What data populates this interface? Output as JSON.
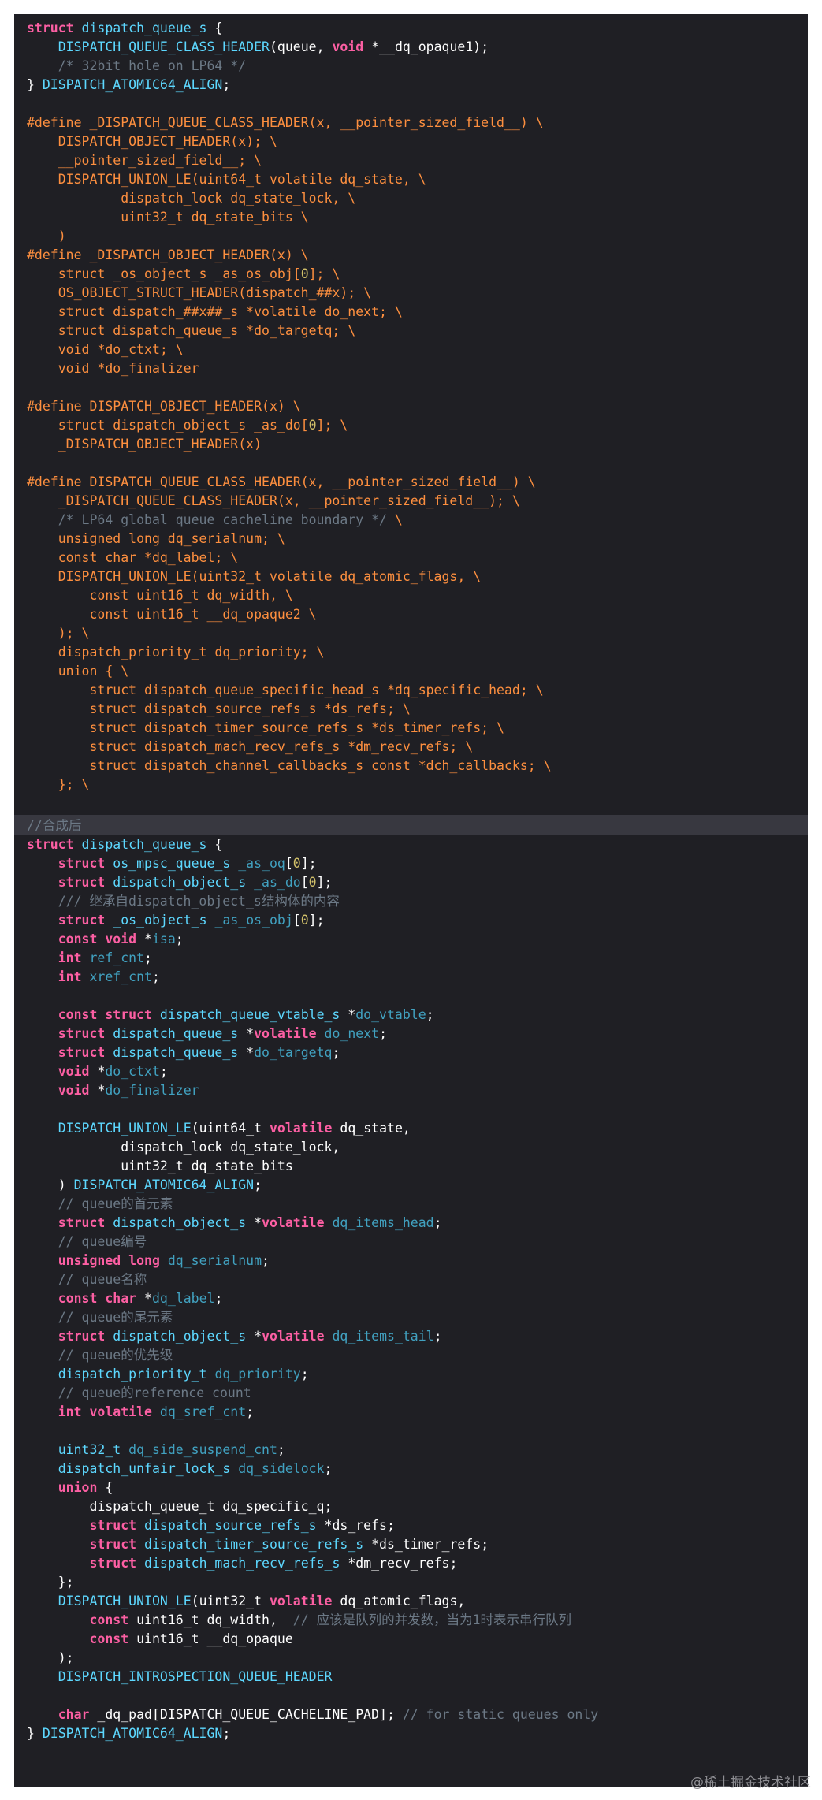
{
  "colors": {
    "background": "#1f1f24",
    "keyword": "#fc5fa3",
    "type": "#5dd8ff",
    "macro": "#fd8f3f",
    "comment": "#6c7986",
    "number": "#d0bf69",
    "plain": "#ffffff",
    "identifier": "#41a1c0"
  },
  "code_top": [
    [
      [
        "kw",
        "struct "
      ],
      [
        "type",
        "dispatch_queue_s"
      ],
      [
        "txt",
        " {"
      ]
    ],
    [
      [
        "txt",
        "    "
      ],
      [
        "type",
        "DISPATCH_QUEUE_CLASS_HEADER"
      ],
      [
        "txt",
        "(queue, "
      ],
      [
        "kw",
        "void"
      ],
      [
        "txt",
        " *__dq_opaque1);"
      ]
    ],
    [
      [
        "txt",
        "    "
      ],
      [
        "cm",
        "/* 32bit hole on LP64 */"
      ]
    ],
    [
      [
        "txt",
        "} "
      ],
      [
        "type",
        "DISPATCH_ATOMIC64_ALIGN"
      ],
      [
        "txt",
        ";"
      ]
    ],
    [],
    [
      [
        "macro",
        "#define _DISPATCH_QUEUE_CLASS_HEADER(x, __pointer_sized_field__) \\"
      ]
    ],
    [
      [
        "macro",
        "    DISPATCH_OBJECT_HEADER(x); \\"
      ]
    ],
    [
      [
        "macro",
        "    __pointer_sized_field__; \\"
      ]
    ],
    [
      [
        "macro",
        "    DISPATCH_UNION_LE(uint64_t volatile dq_state, \\"
      ]
    ],
    [
      [
        "macro",
        "            dispatch_lock dq_state_lock, \\"
      ]
    ],
    [
      [
        "macro",
        "            uint32_t dq_state_bits \\"
      ]
    ],
    [
      [
        "macro",
        "    )"
      ]
    ],
    [
      [
        "macro",
        "#define _DISPATCH_OBJECT_HEADER(x) \\"
      ]
    ],
    [
      [
        "macro",
        "    struct _os_object_s _as_os_obj["
      ],
      [
        "num",
        "0"
      ],
      [
        "macro",
        "]; \\"
      ]
    ],
    [
      [
        "macro",
        "    OS_OBJECT_STRUCT_HEADER(dispatch_##x); \\"
      ]
    ],
    [
      [
        "macro",
        "    struct dispatch_##x##_s *volatile do_next; \\"
      ]
    ],
    [
      [
        "macro",
        "    struct dispatch_queue_s *do_targetq; \\"
      ]
    ],
    [
      [
        "macro",
        "    void *do_ctxt; \\"
      ]
    ],
    [
      [
        "macro",
        "    void *do_finalizer"
      ]
    ],
    [],
    [
      [
        "macro",
        "#define DISPATCH_OBJECT_HEADER(x) \\"
      ]
    ],
    [
      [
        "macro",
        "    struct dispatch_object_s _as_do["
      ],
      [
        "num",
        "0"
      ],
      [
        "macro",
        "]; \\"
      ]
    ],
    [
      [
        "macro",
        "    _DISPATCH_OBJECT_HEADER(x)"
      ]
    ],
    [],
    [
      [
        "macro",
        "#define DISPATCH_QUEUE_CLASS_HEADER(x, __pointer_sized_field__) \\"
      ]
    ],
    [
      [
        "macro",
        "    _DISPATCH_QUEUE_CLASS_HEADER(x, __pointer_sized_field__); \\"
      ]
    ],
    [
      [
        "cm",
        "    /* LP64 global queue cacheline boundary */"
      ],
      [
        "macro",
        " \\"
      ]
    ],
    [
      [
        "macro",
        "    unsigned long dq_serialnum; \\"
      ]
    ],
    [
      [
        "macro",
        "    const char *dq_label; \\"
      ]
    ],
    [
      [
        "macro",
        "    DISPATCH_UNION_LE(uint32_t volatile dq_atomic_flags, \\"
      ]
    ],
    [
      [
        "macro",
        "        const uint16_t dq_width, \\"
      ]
    ],
    [
      [
        "macro",
        "        const uint16_t __dq_opaque2 \\"
      ]
    ],
    [
      [
        "macro",
        "    ); \\"
      ]
    ],
    [
      [
        "macro",
        "    dispatch_priority_t dq_priority; \\"
      ]
    ],
    [
      [
        "macro",
        "    union { \\"
      ]
    ],
    [
      [
        "macro",
        "        struct dispatch_queue_specific_head_s *dq_specific_head; \\"
      ]
    ],
    [
      [
        "macro",
        "        struct dispatch_source_refs_s *ds_refs; \\"
      ]
    ],
    [
      [
        "macro",
        "        struct dispatch_timer_source_refs_s *ds_timer_refs; \\"
      ]
    ],
    [
      [
        "macro",
        "        struct dispatch_mach_recv_refs_s *dm_recv_refs; \\"
      ]
    ],
    [
      [
        "macro",
        "        struct dispatch_channel_callbacks_s const *dch_callbacks; \\"
      ]
    ],
    [
      [
        "macro",
        "    }; \\"
      ]
    ]
  ],
  "code_bottom": [
    [
      [
        "cm",
        "//合成后"
      ]
    ],
    [
      [
        "kw",
        "struct "
      ],
      [
        "type",
        "dispatch_queue_s"
      ],
      [
        "txt",
        " {"
      ]
    ],
    [
      [
        "txt",
        "    "
      ],
      [
        "kw",
        "struct "
      ],
      [
        "type",
        "os_mpsc_queue_s"
      ],
      [
        "txt",
        " "
      ],
      [
        "id",
        "_as_oq"
      ],
      [
        "txt",
        "["
      ],
      [
        "num",
        "0"
      ],
      [
        "txt",
        "];"
      ]
    ],
    [
      [
        "txt",
        "    "
      ],
      [
        "kw",
        "struct "
      ],
      [
        "type",
        "dispatch_object_s"
      ],
      [
        "txt",
        " "
      ],
      [
        "id",
        "_as_do"
      ],
      [
        "txt",
        "["
      ],
      [
        "num",
        "0"
      ],
      [
        "txt",
        "];"
      ]
    ],
    [
      [
        "txt",
        "    "
      ],
      [
        "cm",
        "/// 继承自dispatch_object_s结构体的内容"
      ]
    ],
    [
      [
        "txt",
        "    "
      ],
      [
        "kw",
        "struct "
      ],
      [
        "type",
        "_os_object_s"
      ],
      [
        "txt",
        " "
      ],
      [
        "id",
        "_as_os_obj"
      ],
      [
        "txt",
        "["
      ],
      [
        "num",
        "0"
      ],
      [
        "txt",
        "];"
      ]
    ],
    [
      [
        "txt",
        "    "
      ],
      [
        "kw",
        "const void "
      ],
      [
        "txt",
        "*"
      ],
      [
        "id",
        "isa"
      ],
      [
        "txt",
        ";"
      ]
    ],
    [
      [
        "txt",
        "    "
      ],
      [
        "kw",
        "int "
      ],
      [
        "id",
        "ref_cnt"
      ],
      [
        "txt",
        ";"
      ]
    ],
    [
      [
        "txt",
        "    "
      ],
      [
        "kw",
        "int "
      ],
      [
        "id",
        "xref_cnt"
      ],
      [
        "txt",
        ";"
      ]
    ],
    [],
    [
      [
        "txt",
        "    "
      ],
      [
        "kw",
        "const struct "
      ],
      [
        "type",
        "dispatch_queue_vtable_s"
      ],
      [
        "txt",
        " *"
      ],
      [
        "id",
        "do_vtable"
      ],
      [
        "txt",
        ";"
      ]
    ],
    [
      [
        "txt",
        "    "
      ],
      [
        "kw",
        "struct "
      ],
      [
        "type",
        "dispatch_queue_s"
      ],
      [
        "txt",
        " *"
      ],
      [
        "kw",
        "volatile "
      ],
      [
        "id",
        "do_next"
      ],
      [
        "txt",
        ";"
      ]
    ],
    [
      [
        "txt",
        "    "
      ],
      [
        "kw",
        "struct "
      ],
      [
        "type",
        "dispatch_queue_s"
      ],
      [
        "txt",
        " *"
      ],
      [
        "id",
        "do_targetq"
      ],
      [
        "txt",
        ";"
      ]
    ],
    [
      [
        "txt",
        "    "
      ],
      [
        "kw",
        "void "
      ],
      [
        "txt",
        "*"
      ],
      [
        "id",
        "do_ctxt"
      ],
      [
        "txt",
        ";"
      ]
    ],
    [
      [
        "txt",
        "    "
      ],
      [
        "kw",
        "void "
      ],
      [
        "txt",
        "*"
      ],
      [
        "id",
        "do_finalizer"
      ]
    ],
    [],
    [
      [
        "txt",
        "    "
      ],
      [
        "type",
        "DISPATCH_UNION_LE"
      ],
      [
        "txt",
        "(uint64_t "
      ],
      [
        "kw",
        "volatile"
      ],
      [
        "txt",
        " dq_state,"
      ]
    ],
    [
      [
        "txt",
        "            dispatch_lock dq_state_lock,"
      ]
    ],
    [
      [
        "txt",
        "            uint32_t dq_state_bits"
      ]
    ],
    [
      [
        "txt",
        "    ) "
      ],
      [
        "type",
        "DISPATCH_ATOMIC64_ALIGN"
      ],
      [
        "txt",
        ";"
      ]
    ],
    [
      [
        "txt",
        "    "
      ],
      [
        "cm",
        "// queue的首元素"
      ]
    ],
    [
      [
        "txt",
        "    "
      ],
      [
        "kw",
        "struct "
      ],
      [
        "type",
        "dispatch_object_s"
      ],
      [
        "txt",
        " *"
      ],
      [
        "kw",
        "volatile "
      ],
      [
        "id",
        "dq_items_head"
      ],
      [
        "txt",
        ";"
      ]
    ],
    [
      [
        "txt",
        "    "
      ],
      [
        "cm",
        "// queue编号"
      ]
    ],
    [
      [
        "txt",
        "    "
      ],
      [
        "kw",
        "unsigned long "
      ],
      [
        "id",
        "dq_serialnum"
      ],
      [
        "txt",
        ";"
      ]
    ],
    [
      [
        "txt",
        "    "
      ],
      [
        "cm",
        "// queue名称"
      ]
    ],
    [
      [
        "txt",
        "    "
      ],
      [
        "kw",
        "const char "
      ],
      [
        "txt",
        "*"
      ],
      [
        "id",
        "dq_label"
      ],
      [
        "txt",
        ";"
      ]
    ],
    [
      [
        "txt",
        "    "
      ],
      [
        "cm",
        "// queue的尾元素"
      ]
    ],
    [
      [
        "txt",
        "    "
      ],
      [
        "kw",
        "struct "
      ],
      [
        "type",
        "dispatch_object_s"
      ],
      [
        "txt",
        " *"
      ],
      [
        "kw",
        "volatile "
      ],
      [
        "id",
        "dq_items_tail"
      ],
      [
        "txt",
        ";"
      ]
    ],
    [
      [
        "txt",
        "    "
      ],
      [
        "cm",
        "// queue的优先级"
      ]
    ],
    [
      [
        "txt",
        "    "
      ],
      [
        "type",
        "dispatch_priority_t"
      ],
      [
        "txt",
        " "
      ],
      [
        "id",
        "dq_priority"
      ],
      [
        "txt",
        ";"
      ]
    ],
    [
      [
        "txt",
        "    "
      ],
      [
        "cm",
        "// queue的reference count"
      ]
    ],
    [
      [
        "txt",
        "    "
      ],
      [
        "kw",
        "int volatile "
      ],
      [
        "id",
        "dq_sref_cnt"
      ],
      [
        "txt",
        ";"
      ]
    ],
    [],
    [
      [
        "txt",
        "    "
      ],
      [
        "type",
        "uint32_t"
      ],
      [
        "txt",
        " "
      ],
      [
        "id",
        "dq_side_suspend_cnt"
      ],
      [
        "txt",
        ";"
      ]
    ],
    [
      [
        "txt",
        "    "
      ],
      [
        "type",
        "dispatch_unfair_lock_s"
      ],
      [
        "txt",
        " "
      ],
      [
        "id",
        "dq_sidelock"
      ],
      [
        "txt",
        ";"
      ]
    ],
    [
      [
        "txt",
        "    "
      ],
      [
        "kw",
        "union "
      ],
      [
        "txt",
        "{"
      ]
    ],
    [
      [
        "txt",
        "        dispatch_queue_t dq_specific_q;"
      ]
    ],
    [
      [
        "txt",
        "        "
      ],
      [
        "kw",
        "struct "
      ],
      [
        "type",
        "dispatch_source_refs_s"
      ],
      [
        "txt",
        " *ds_refs;"
      ]
    ],
    [
      [
        "txt",
        "        "
      ],
      [
        "kw",
        "struct "
      ],
      [
        "type",
        "dispatch_timer_source_refs_s"
      ],
      [
        "txt",
        " *ds_timer_refs;"
      ]
    ],
    [
      [
        "txt",
        "        "
      ],
      [
        "kw",
        "struct "
      ],
      [
        "type",
        "dispatch_mach_recv_refs_s"
      ],
      [
        "txt",
        " *dm_recv_refs;"
      ]
    ],
    [
      [
        "txt",
        "    };"
      ]
    ],
    [
      [
        "txt",
        "    "
      ],
      [
        "type",
        "DISPATCH_UNION_LE"
      ],
      [
        "txt",
        "(uint32_t "
      ],
      [
        "kw",
        "volatile"
      ],
      [
        "txt",
        " dq_atomic_flags,"
      ]
    ],
    [
      [
        "txt",
        "        "
      ],
      [
        "kw",
        "const "
      ],
      [
        "txt",
        "uint16_t dq_width,  "
      ],
      [
        "cm",
        "// 应该是队列的并发数，当为1时表示串行队列"
      ]
    ],
    [
      [
        "txt",
        "        "
      ],
      [
        "kw",
        "const "
      ],
      [
        "txt",
        "uint16_t __dq_opaque"
      ]
    ],
    [
      [
        "txt",
        "    );"
      ]
    ],
    [
      [
        "txt",
        "    "
      ],
      [
        "type",
        "DISPATCH_INTROSPECTION_QUEUE_HEADER"
      ]
    ],
    [],
    [
      [
        "txt",
        "    "
      ],
      [
        "kw",
        "char "
      ],
      [
        "txt",
        "_dq_pad[DISPATCH_QUEUE_CACHELINE_PAD]; "
      ],
      [
        "cm",
        "// for static queues only"
      ]
    ],
    [
      [
        "txt",
        "} "
      ],
      [
        "type",
        "DISPATCH_ATOMIC64_ALIGN"
      ],
      [
        "txt",
        ";"
      ]
    ]
  ],
  "watermark": "@稀土掘金技术社区"
}
